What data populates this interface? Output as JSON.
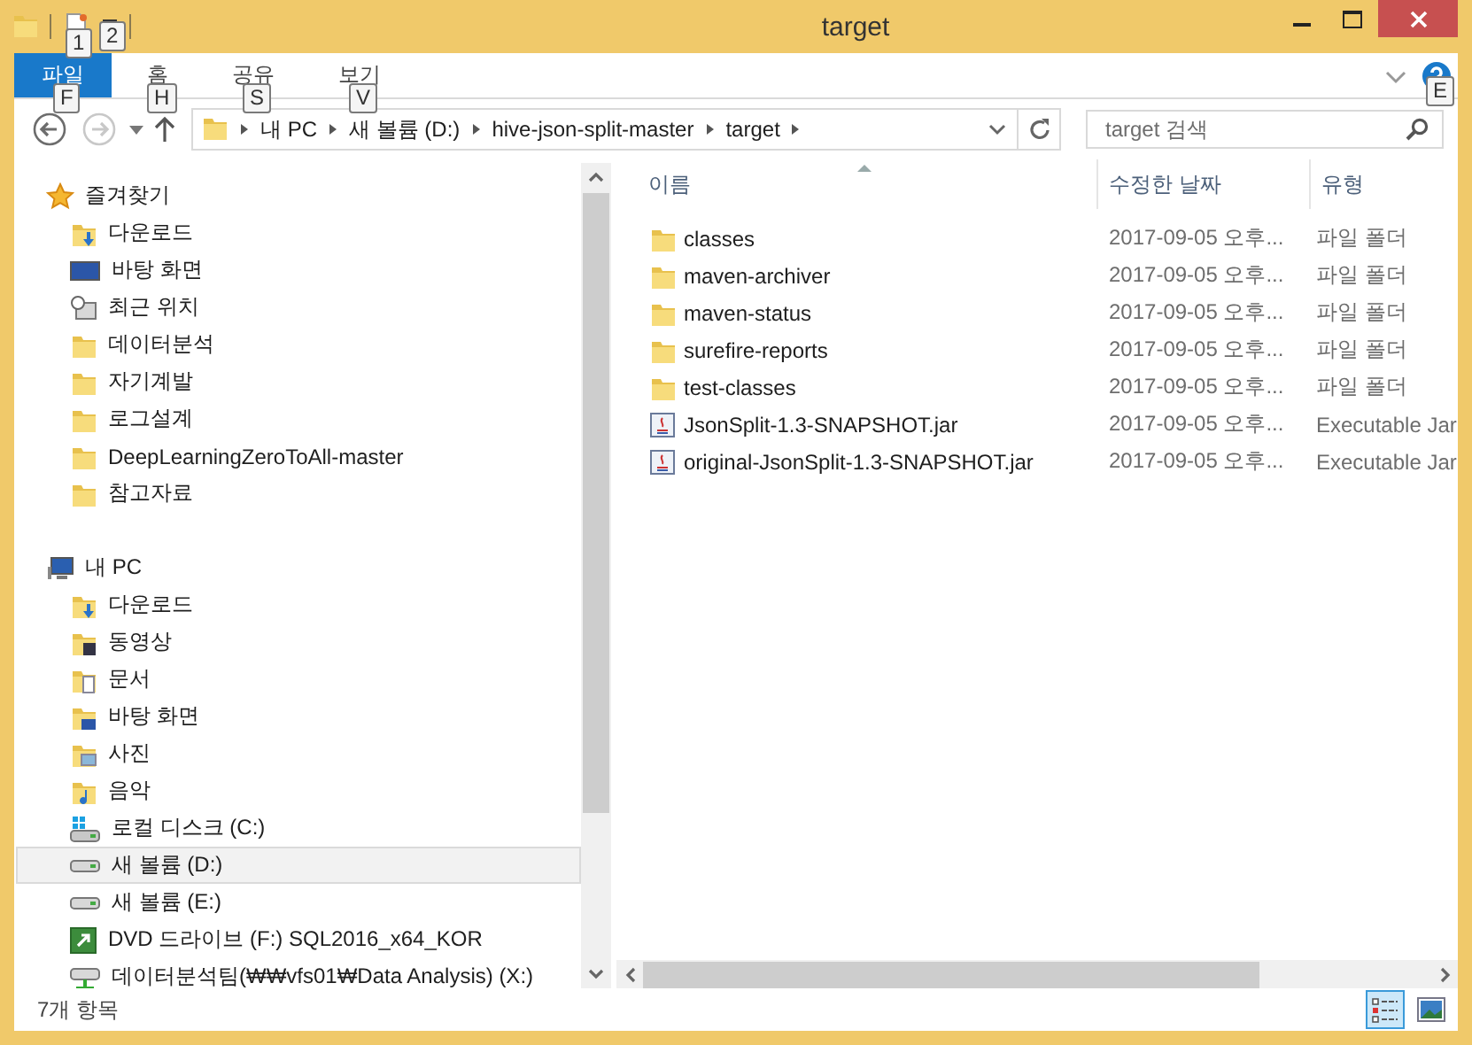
{
  "window": {
    "title": "target"
  },
  "quick_access": [
    {
      "kind": "folder"
    },
    {
      "kind": "new-folder"
    },
    {
      "kind": "dropdown"
    }
  ],
  "ribbon_tabs": [
    {
      "label": "파일",
      "selected": true
    },
    {
      "label": "홈",
      "selected": false
    },
    {
      "label": "공유",
      "selected": false
    },
    {
      "label": "보기",
      "selected": false
    }
  ],
  "key_tips": [
    "1",
    "2",
    "F",
    "H",
    "S",
    "V",
    "E"
  ],
  "back": {
    "disabled": false
  },
  "forward": {
    "disabled": true
  },
  "breadcrumb": [
    "내 PC",
    "새 볼륨 (D:)",
    "hive-json-split-master",
    "target"
  ],
  "search": {
    "placeholder": "target 검색"
  },
  "nav": [
    {
      "label": "즐겨찾기",
      "kind": "favorites",
      "children": [
        {
          "label": "다운로드",
          "kind": "download",
          "selected": false
        },
        {
          "label": "바탕 화면",
          "kind": "desktop",
          "selected": false
        },
        {
          "label": "최근 위치",
          "kind": "recent",
          "selected": false
        },
        {
          "label": "데이터분석",
          "kind": "folder",
          "selected": false
        },
        {
          "label": "자기계발",
          "kind": "folder",
          "selected": false
        },
        {
          "label": "로그설계",
          "kind": "folder",
          "selected": false
        },
        {
          "label": "DeepLearningZeroToAll-master",
          "kind": "folder",
          "selected": false
        },
        {
          "label": "참고자료",
          "kind": "folder",
          "selected": false
        }
      ]
    },
    {
      "label": "내 PC",
      "kind": "pc",
      "children": [
        {
          "label": "다운로드",
          "kind": "download",
          "selected": false
        },
        {
          "label": "동영상",
          "kind": "video",
          "selected": false
        },
        {
          "label": "문서",
          "kind": "docs",
          "selected": false
        },
        {
          "label": "바탕 화면",
          "kind": "desktopfolder",
          "selected": false
        },
        {
          "label": "사진",
          "kind": "pictures",
          "selected": false
        },
        {
          "label": "음악",
          "kind": "music",
          "selected": false
        },
        {
          "label": "로컬 디스크 (C:)",
          "kind": "systemdrive",
          "selected": false
        },
        {
          "label": "새 볼륨 (D:)",
          "kind": "drive",
          "selected": true
        },
        {
          "label": "새 볼륨 (E:)",
          "kind": "drive",
          "selected": false
        },
        {
          "label": "DVD 드라이브 (F:) SQL2016_x64_KOR",
          "kind": "dvd",
          "selected": false
        },
        {
          "label": "데이터분석팀(₩₩vfs01₩Data Analysis) (X:)",
          "kind": "network",
          "selected": false
        }
      ]
    }
  ],
  "table": {
    "columns": [
      "이름",
      "수정한 날짜",
      "유형"
    ],
    "rows": [
      {
        "kind": "folder",
        "cells": [
          "classes",
          "2017-09-05 오후...",
          "파일 폴더"
        ]
      },
      {
        "kind": "folder",
        "cells": [
          "maven-archiver",
          "2017-09-05 오후...",
          "파일 폴더"
        ]
      },
      {
        "kind": "folder",
        "cells": [
          "maven-status",
          "2017-09-05 오후...",
          "파일 폴더"
        ]
      },
      {
        "kind": "folder",
        "cells": [
          "surefire-reports",
          "2017-09-05 오후...",
          "파일 폴더"
        ]
      },
      {
        "kind": "folder",
        "cells": [
          "test-classes",
          "2017-09-05 오후...",
          "파일 폴더"
        ]
      },
      {
        "kind": "jar",
        "cells": [
          "JsonSplit-1.3-SNAPSHOT.jar",
          "2017-09-05 오후...",
          "Executable Jar"
        ]
      },
      {
        "kind": "jar",
        "cells": [
          "original-JsonSplit-1.3-SNAPSHOT.jar",
          "2017-09-05 오후...",
          "Executable Jar"
        ]
      }
    ]
  },
  "status_bar": {
    "text": "7개 항목"
  },
  "view_buttons": [
    {
      "kind": "details",
      "selected": true
    },
    {
      "kind": "large-icons",
      "selected": false
    }
  ]
}
